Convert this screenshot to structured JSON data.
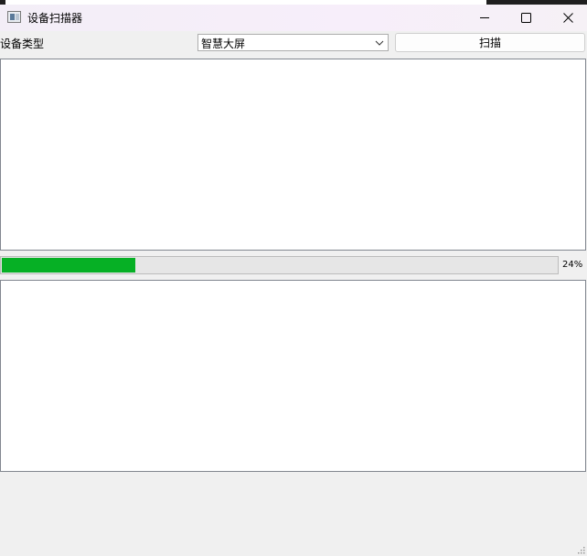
{
  "window": {
    "title": "设备扫描器",
    "icon": "app-window-icon"
  },
  "toolbar": {
    "device_type_label": "设备类型",
    "device_type_selected": "智慧大屏",
    "scan_label": "扫描"
  },
  "progress": {
    "value": 0.24,
    "text": "24%",
    "fill_color": "#06b025"
  },
  "output_top": {
    "text": ""
  },
  "output_bottom": {
    "text": ""
  }
}
